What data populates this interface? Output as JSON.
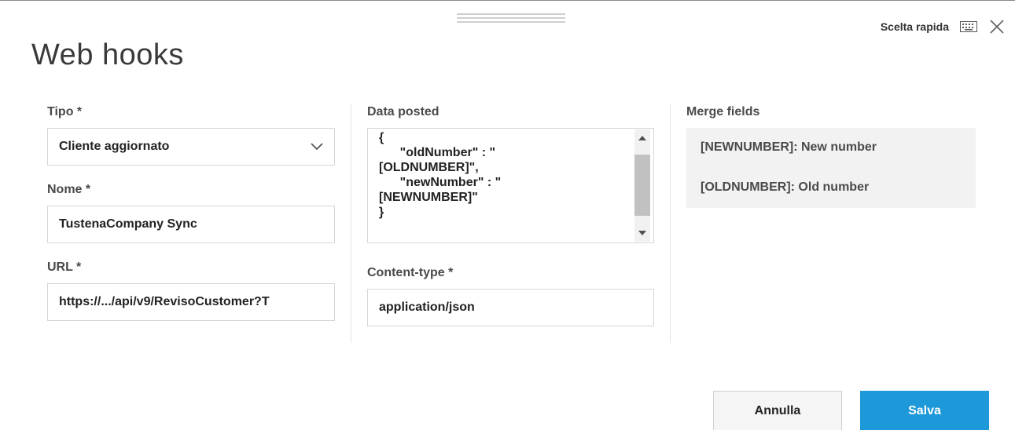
{
  "header": {
    "title": "Web hooks",
    "shortcut_label": "Scelta rapida"
  },
  "form": {
    "tipo": {
      "label": "Tipo *",
      "value": "Cliente aggiornato"
    },
    "nome": {
      "label": "Nome *",
      "value": "TustenaCompany Sync"
    },
    "url": {
      "label": "URL *",
      "value": "https://.../api/v9/RevisoCustomer?T"
    },
    "data_posted": {
      "label": "Data posted",
      "value": "{\n      \"oldNumber\" : \"\n[OLDNUMBER]\",\n      \"newNumber\" : \"\n[NEWNUMBER]\"\n}"
    },
    "content_type": {
      "label": "Content-type *",
      "value": "application/json"
    }
  },
  "merge_fields": {
    "label": "Merge fields",
    "items": [
      "[NEWNUMBER]: New number",
      "[OLDNUMBER]: Old number"
    ]
  },
  "buttons": {
    "cancel_label": "Annulla",
    "save_label": "Salva"
  },
  "colors": {
    "primary": "#1d98d8",
    "panel": "#f2f2f2",
    "border": "#d6d6d6"
  }
}
